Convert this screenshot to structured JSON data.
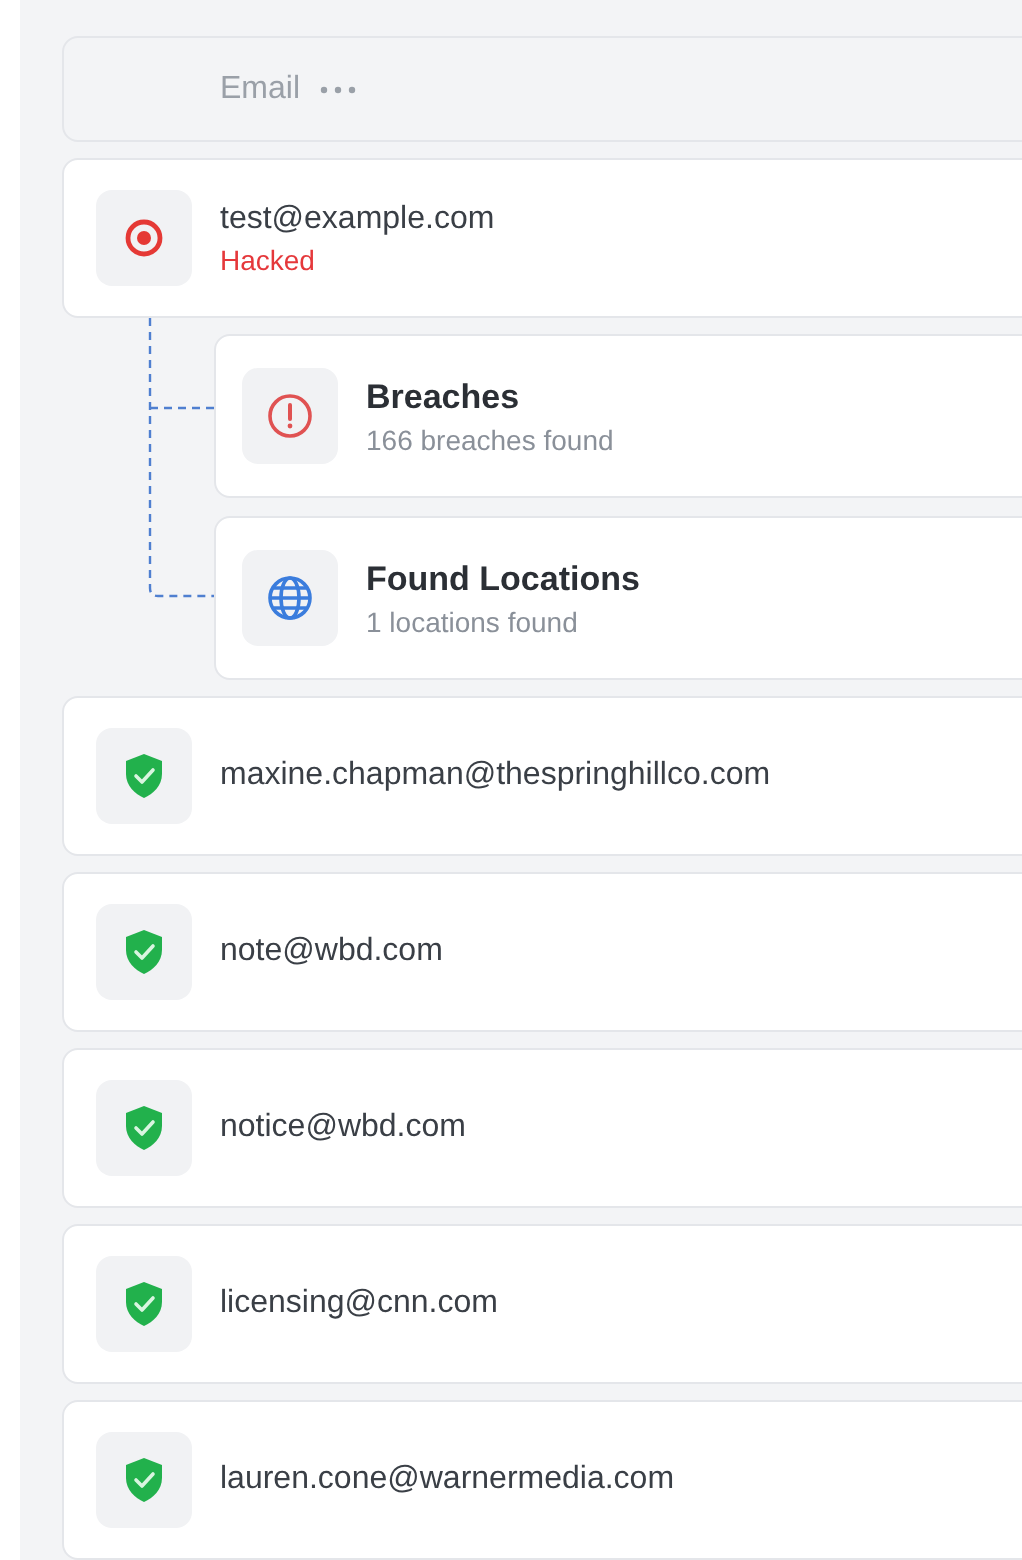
{
  "header": {
    "label": "Email"
  },
  "emails": [
    {
      "address": "test@example.com",
      "kind": "hacked",
      "status": "Hacked",
      "findings": [
        {
          "kind": "breaches",
          "title": "Breaches",
          "subtitle": "166 breaches found"
        },
        {
          "kind": "locations",
          "title": "Found Locations",
          "subtitle": "1 locations found"
        }
      ]
    },
    {
      "address": "maxine.chapman@thespringhillco.com",
      "kind": "safe"
    },
    {
      "address": "note@wbd.com",
      "kind": "safe"
    },
    {
      "address": "notice@wbd.com",
      "kind": "safe"
    },
    {
      "address": "licensing@cnn.com",
      "kind": "safe"
    },
    {
      "address": "lauren.cone@warnermedia.com",
      "kind": "safe"
    }
  ]
}
